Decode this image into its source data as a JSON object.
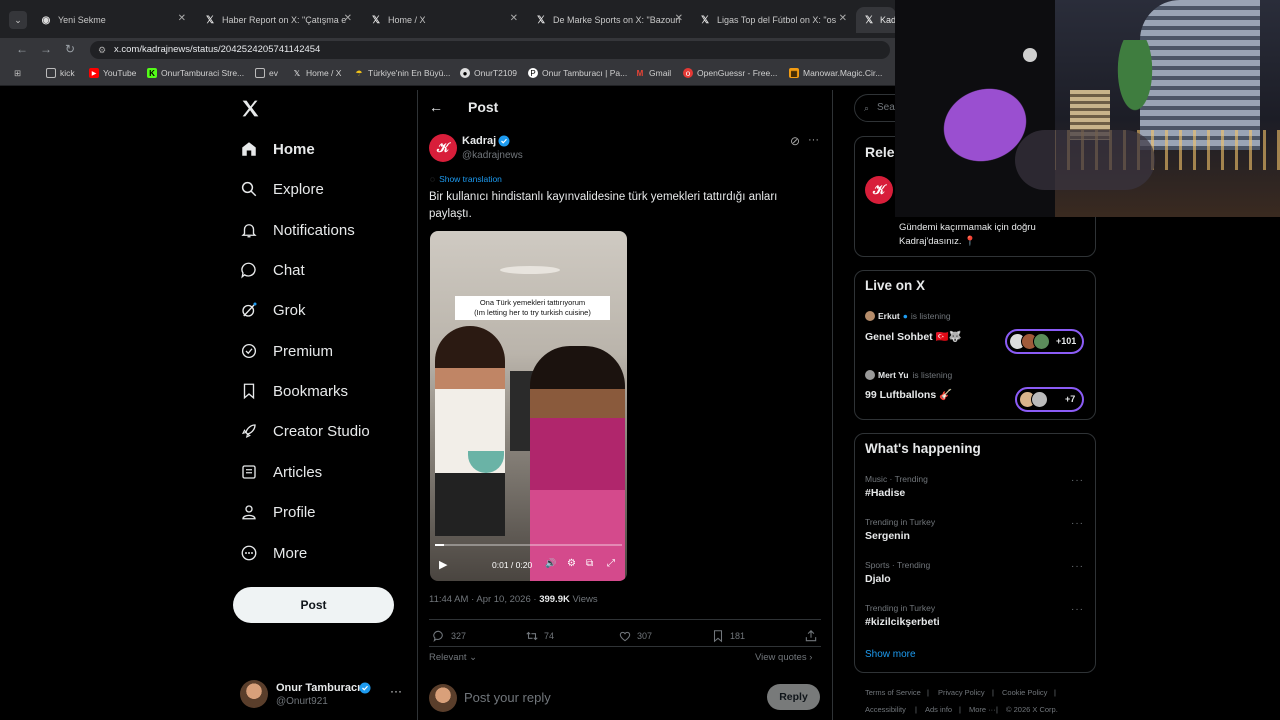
{
  "tabs": [
    {
      "title": "Yeni Sekme",
      "icon": "chrome-icon"
    },
    {
      "title": "Haber Report on X: \"Çatışma e",
      "icon": "x-logo-icon"
    },
    {
      "title": "Home / X",
      "icon": "x-logo-icon"
    },
    {
      "title": "De Marke Sports on X: \"Bazoun",
      "icon": "x-logo-icon"
    },
    {
      "title": "Ligas Top del Fútbol on X: \"os",
      "icon": "x-logo-icon"
    },
    {
      "title": "Kad",
      "icon": "x-logo-icon"
    }
  ],
  "url": "x.com/kadrajnews/status/2042524205741142454",
  "bookmarks": [
    "kick",
    "YouTube",
    "OnurTamburaci Stre...",
    "ev",
    "Home / X",
    "Türkiye'nin En Büyü...",
    "OnurT2109",
    "Onur Tamburacı | Pa...",
    "Gmail",
    "OpenGuessr - Free...",
    "Manowar.Magic.Cir..."
  ],
  "nav": {
    "items": [
      {
        "label": "Home",
        "icon": "home-icon"
      },
      {
        "label": "Explore",
        "icon": "search-icon"
      },
      {
        "label": "Notifications",
        "icon": "bell-icon"
      },
      {
        "label": "Chat",
        "icon": "chat-icon"
      },
      {
        "label": "Grok",
        "icon": "grok-icon"
      },
      {
        "label": "Premium",
        "icon": "verified-icon"
      },
      {
        "label": "Bookmarks",
        "icon": "bookmark-icon"
      },
      {
        "label": "Creator Studio",
        "icon": "rocket-icon"
      },
      {
        "label": "Articles",
        "icon": "article-icon"
      },
      {
        "label": "Profile",
        "icon": "person-icon"
      },
      {
        "label": "More",
        "icon": "more-circle-icon"
      }
    ],
    "post_label": "Post",
    "account": {
      "name": "Onur Tamburacı",
      "handle": "@Onurt921"
    }
  },
  "header": {
    "title": "Post"
  },
  "tweet": {
    "author": "Kadraj",
    "handle": "@kadrajnews",
    "show_translation": "Show translation",
    "text_line1": "Bir kullanıcı hindistanlı kayınvalidesine türk yemekleri tattırdığı anları",
    "text_line2": "paylaştı.",
    "video_caption_1": "Ona Türk yemekleri tattırıyorum",
    "video_caption_2": "(Im letting her to try turkish cuisine)",
    "video_time": "0:01 / 0:20",
    "video_progress": 0.05,
    "timestamp": "11:44 AM · Apr 10, 2026 · ",
    "views": "399.9K",
    "views_label": " Views",
    "replies": "327",
    "reposts": "74",
    "likes": "307",
    "bookmarks": "181",
    "sort_label": "Relevant",
    "view_quotes": "View quotes",
    "reply_placeholder": "Post your reply",
    "reply_button": "Reply"
  },
  "right": {
    "search_placeholder": "Sea",
    "relevant_title": "Rele",
    "relevant_bio_1": "Gündemi kaçırmamak için doğru",
    "relevant_bio_2": "Kadraj'dasınız. 📍",
    "live_title": "Live on X",
    "spaces": [
      {
        "host": "Erkut",
        "status": "is listening",
        "title": "Genel Sohbet 🇹🇷🐺",
        "count": "+101"
      },
      {
        "host": "Mert Yu",
        "status": "is listening",
        "title": "99 Luftballons 🎸",
        "count": "+7"
      }
    ],
    "happening_title": "What's happening",
    "trends": [
      {
        "meta": "Music · Trending",
        "name": "#Hadise"
      },
      {
        "meta": "Trending in Turkey",
        "name": "Sergenin"
      },
      {
        "meta": "Sports · Trending",
        "name": "Djalo"
      },
      {
        "meta": "Trending in Turkey",
        "name": "#kizilcikşerbeti"
      }
    ],
    "show_more": "Show more",
    "footer": [
      "Terms of Service",
      "Privacy Policy",
      "Cookie Policy",
      "Accessibility",
      "Ads info",
      "More ···",
      "© 2026 X Corp."
    ]
  },
  "colors": {
    "accent": "#1d9bf0",
    "brand_red": "#d81e3a",
    "border": "#2f3336",
    "muted": "#71767b",
    "space_purple": "#8b5cf6"
  }
}
